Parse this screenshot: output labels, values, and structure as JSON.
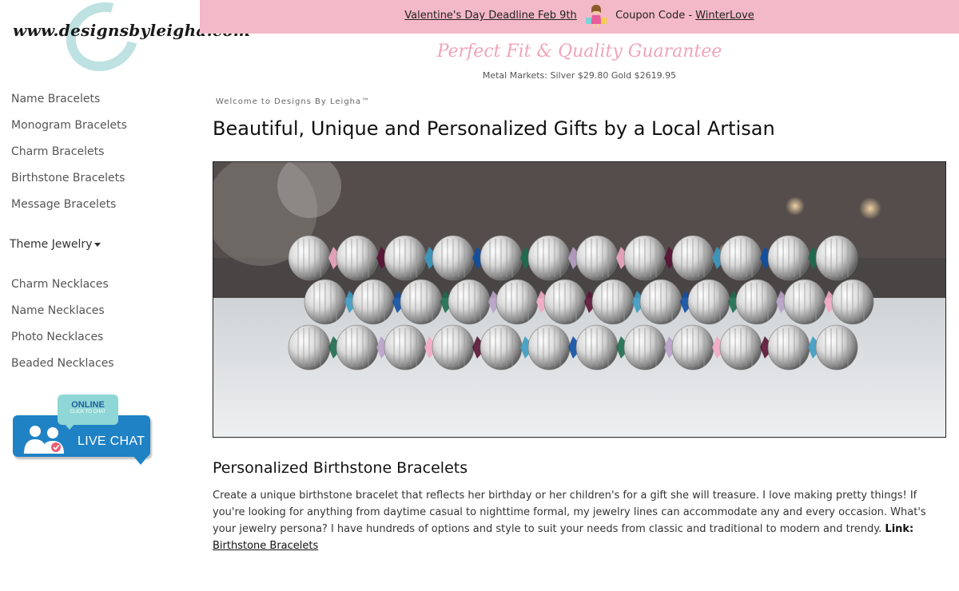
{
  "logo": {
    "text": "www.designsbyleigha.com"
  },
  "nav": {
    "items": [
      {
        "label": "Name Bracelets"
      },
      {
        "label": "Monogram Bracelets"
      },
      {
        "label": "Charm Bracelets"
      },
      {
        "label": "Birthstone Bracelets"
      },
      {
        "label": "Message Bracelets"
      }
    ],
    "theme_label": "Theme Jewelry",
    "necklaces": [
      {
        "label": "Charm Necklaces"
      },
      {
        "label": "Name Necklaces"
      },
      {
        "label": "Photo Necklaces"
      },
      {
        "label": "Beaded Necklaces"
      }
    ]
  },
  "chat": {
    "online": "ONLINE",
    "click": "CLICK TO CHAT",
    "label": "LIVE CHAT"
  },
  "banner": {
    "deadline": "Valentine's Day Deadline Feb 9th",
    "coupon_prefix": "Coupon Code -",
    "coupon": "WinterLove"
  },
  "tagline": "Perfect Fit & Quality Guarantee",
  "metals": "Metal Markets: Silver $29.80 Gold $2619.95",
  "welcome": "Welcome to Designs By Leigha™",
  "headline": "Beautiful, Unique and Personalized Gifts by a Local Artisan",
  "section": {
    "title": "Personalized Birthstone Bracelets",
    "body": "Create a unique birthstone bracelet that reflects her birthday or her children's for a gift she will treasure. I love making pretty things! If you're looking for anything from daytime casual to nighttime formal, my jewelry lines can accommodate any and every occasion. What's your jewelry persona? I have hundreds of options and style to suit your needs from classic and traditional to modern and trendy.",
    "link_prefix": "Link:",
    "link": "Birthstone Bracelets"
  },
  "colors": {
    "banner": "#f4b9c8",
    "tagline": "#f0a4b8",
    "chat": "#1f82c4",
    "chat_online": "#8fd6d6"
  }
}
